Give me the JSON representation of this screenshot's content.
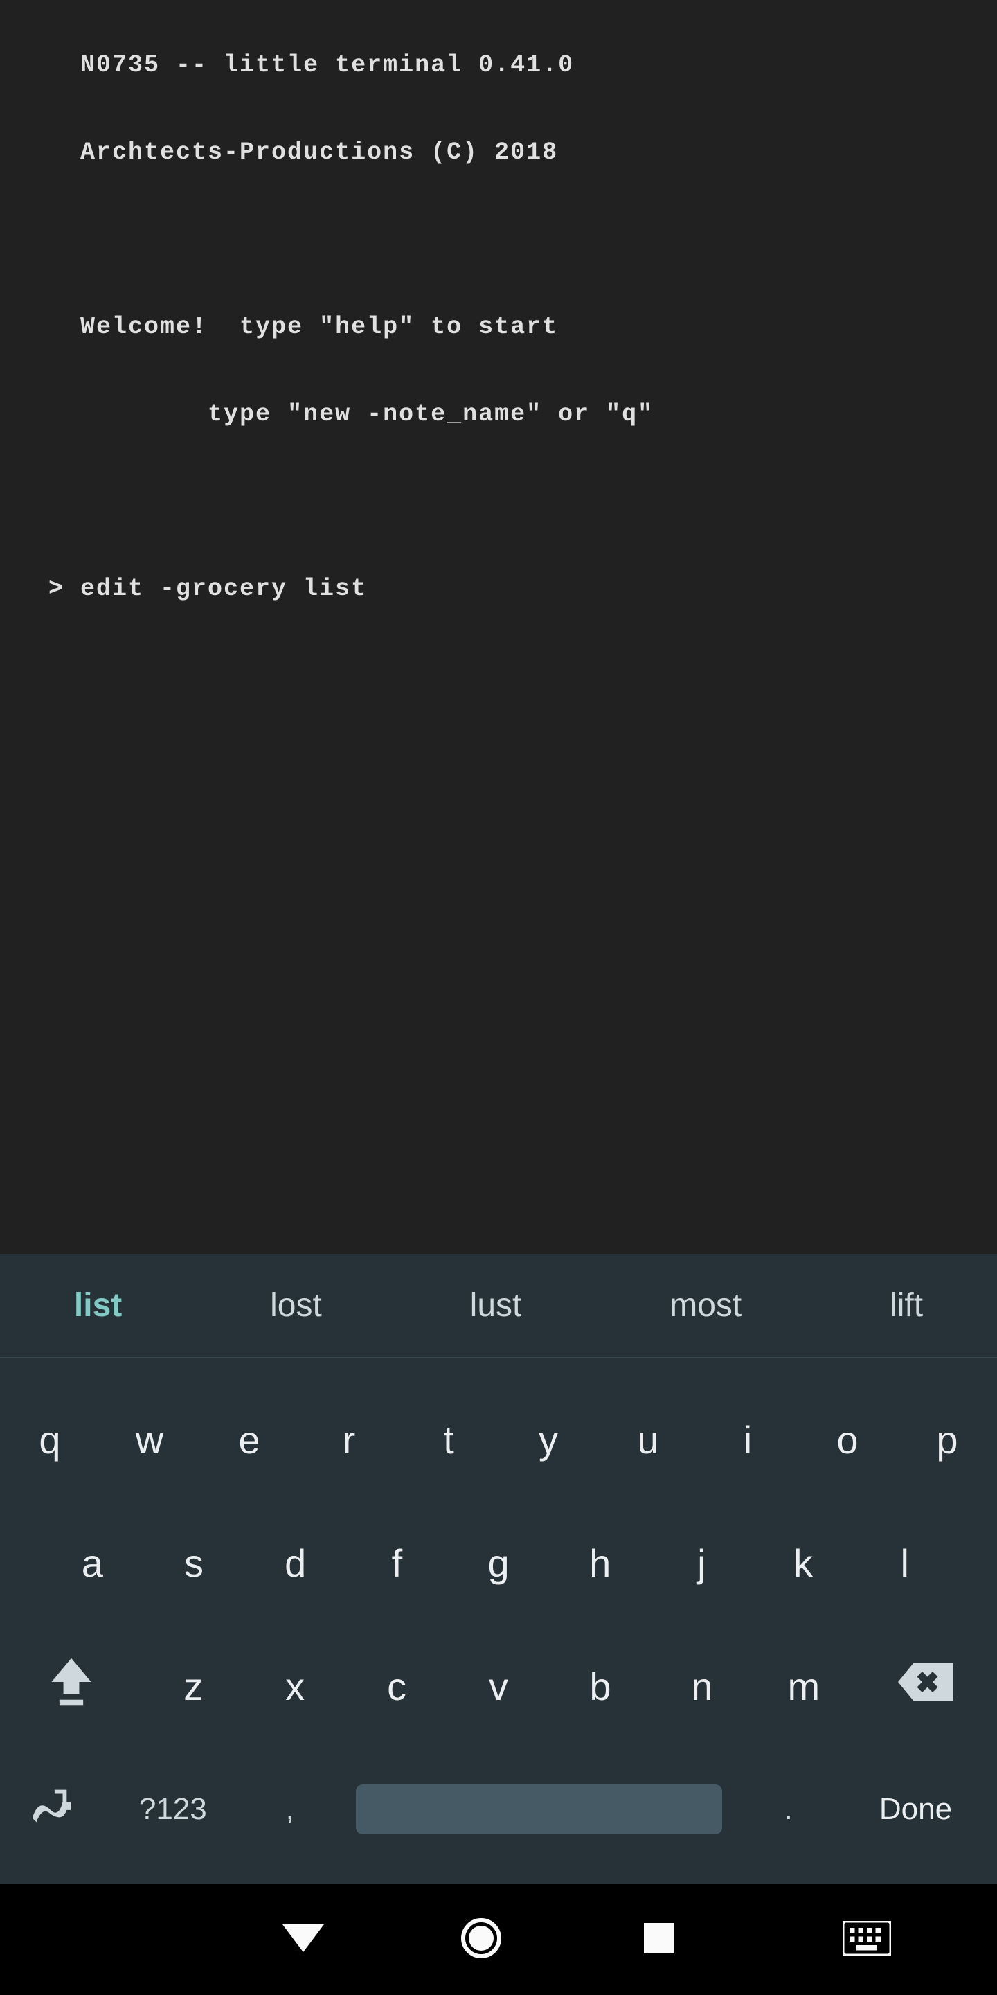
{
  "terminal": {
    "line1": "  N0735 -- little terminal 0.41.0",
    "line2": "  Archtects-Productions (C) 2018",
    "blank1": " ",
    "line3": "  Welcome!  type \"help\" to start",
    "line4": "          type \"new -note_name\" or \"q\"",
    "blank2": " ",
    "prompt": "> edit -grocery list"
  },
  "keyboard": {
    "suggestions": [
      "list",
      "lost",
      "lust",
      "most",
      "lift"
    ],
    "row1": [
      "q",
      "w",
      "e",
      "r",
      "t",
      "y",
      "u",
      "i",
      "o",
      "p"
    ],
    "row2": [
      "a",
      "s",
      "d",
      "f",
      "g",
      "h",
      "j",
      "k",
      "l"
    ],
    "row3": [
      "z",
      "x",
      "c",
      "v",
      "b",
      "n",
      "m"
    ],
    "numtoggle": "?123",
    "comma": ",",
    "period": ".",
    "done": "Done"
  }
}
